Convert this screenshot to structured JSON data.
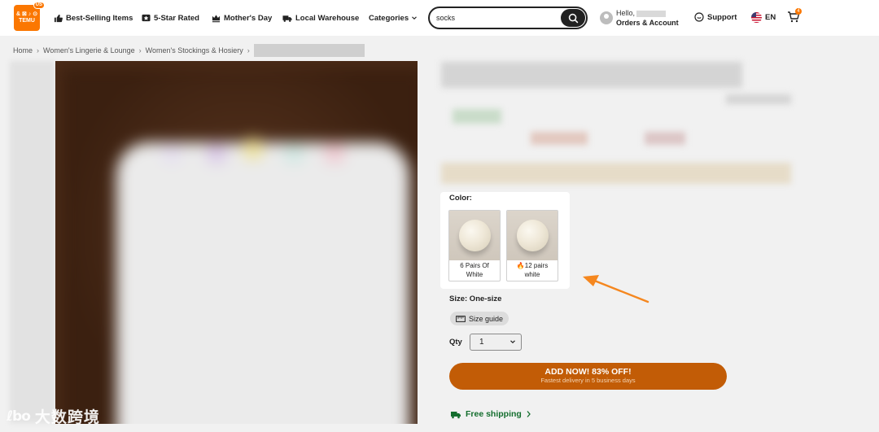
{
  "header": {
    "logo_text_top": "& ⊠ ♪ ⊙",
    "logo_text_bottom": "TEMU",
    "logo_badge": "US",
    "nav": {
      "best_selling": "Best-Selling Items",
      "five_star": "5-Star Rated",
      "mothers_day": "Mother's Day",
      "local_warehouse": "Local Warehouse",
      "categories": "Categories"
    },
    "search_value": "socks",
    "account_hello": "Hello,",
    "account_orders": "Orders & Account",
    "support": "Support",
    "language": "EN",
    "cart_count": "4"
  },
  "breadcrumb": {
    "items": [
      "Home",
      "Women's Lingerie & Lounge",
      "Women's Stockings & Hosiery"
    ],
    "separator": "›"
  },
  "product": {
    "color_label": "Color:",
    "colors": [
      {
        "line1": "6 Pairs Of",
        "line2": "White"
      },
      {
        "line1": "12 pairs",
        "line2": "white"
      }
    ],
    "size_label": "Size: One-size",
    "size_guide": "Size guide",
    "qty_label": "Qty",
    "qty_value": "1",
    "cta_main": "ADD NOW! 83% OFF!",
    "cta_sub": "Fastest delivery in 5 business days",
    "shipping": "Free shipping"
  },
  "watermark": {
    "mark": "ℓbo",
    "text": "大数跨境"
  },
  "colors": {
    "brand_orange": "#fb7701",
    "cta_dim": "#c25c06",
    "shipping_green": "#146e2e",
    "arrow_orange": "#f5871f"
  }
}
